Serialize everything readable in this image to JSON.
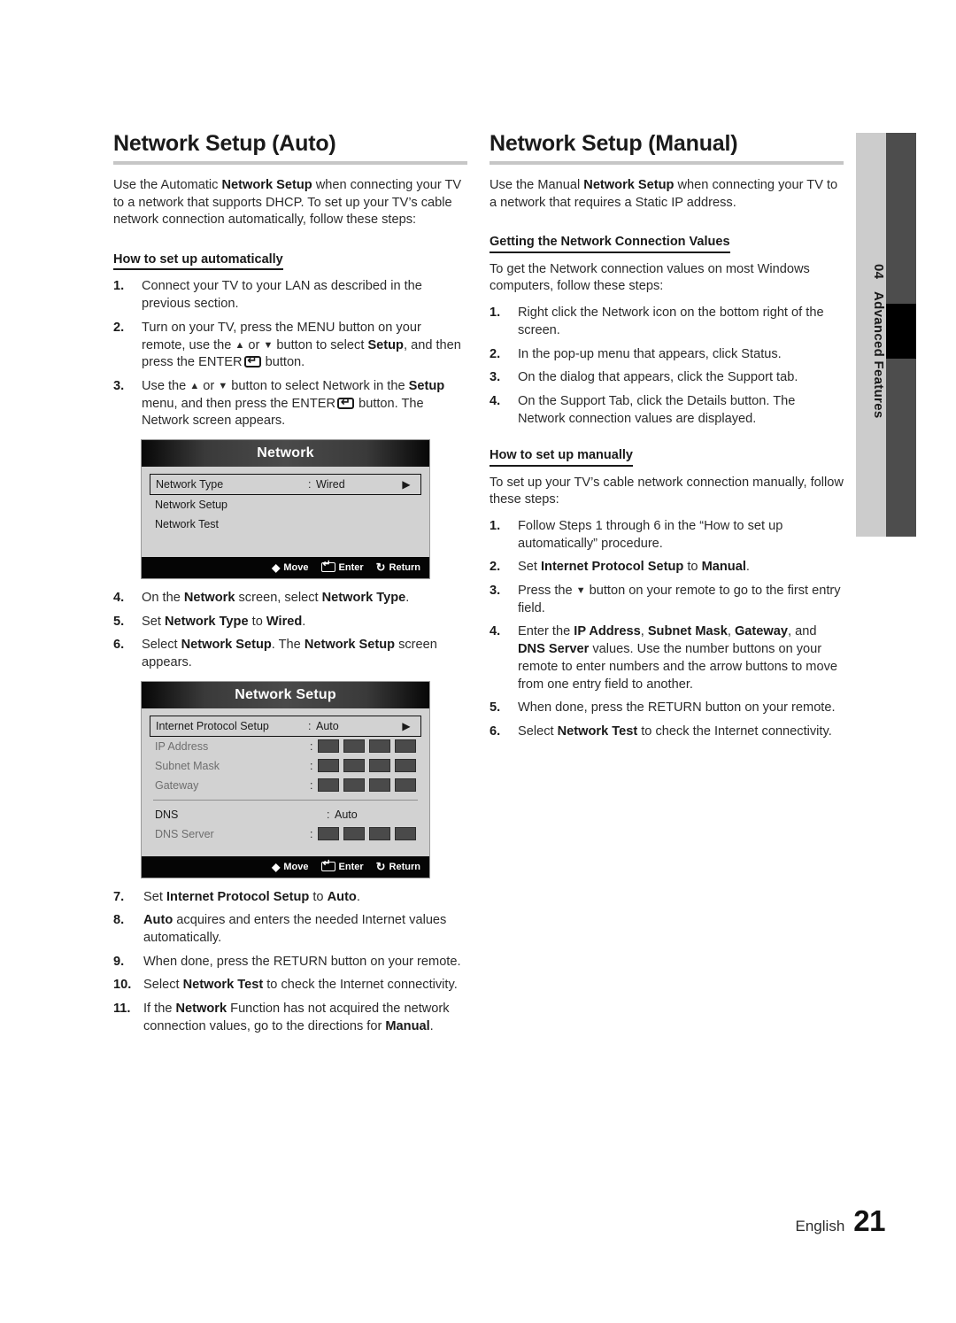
{
  "document": {
    "side_tab": {
      "number": "04",
      "label": "Advanced Features"
    },
    "footer": {
      "language": "English",
      "page_number": "21"
    }
  },
  "left_column": {
    "heading": "Network Setup (Auto)",
    "intro": "Use the Automatic <b>Network Setup</b> when connecting your TV to a network that supports DHCP. To set up your TV’s cable network connection automatically, follow these steps:",
    "subheading": "How to set up automatically",
    "steps_1_3": [
      {
        "num": "1.",
        "text": "Connect your TV to your LAN as described in the previous section."
      },
      {
        "num": "2.",
        "text": "Turn on your TV, press the MENU button on your remote, use the <span class=\"arw\">▲</span> or <span class=\"arw\">▼</span> button to select <b>Setup</b>, and then press the ENTER<span class=\"enterkey\"></span> button."
      },
      {
        "num": "3.",
        "text": "Use the <span class=\"arw\">▲</span> or <span class=\"arw\">▼</span> button to select Network in the <b>Setup</b> menu, and then press the ENTER<span class=\"enterkey\"></span> button. The Network screen appears."
      }
    ],
    "steps_4_6": [
      {
        "num": "4.",
        "text": "On the <b>Network</b> screen, select <b>Network Type</b>."
      },
      {
        "num": "5.",
        "text": "Set <b>Network Type</b> to <b>Wired</b>."
      },
      {
        "num": "6.",
        "text": "Select <b>Network Setup</b>. The <b>Network Setup</b> screen appears."
      }
    ],
    "steps_7_11": [
      {
        "num": "7.",
        "text": "Set <b>Internet Protocol Setup</b> to <b>Auto</b>."
      },
      {
        "num": "8.",
        "text": "<b>Auto</b> acquires and enters the needed Internet values automatically."
      },
      {
        "num": "9.",
        "text": "When done, press the RETURN button on your remote."
      },
      {
        "num": "10.",
        "text": "Select <b>Network Test</b> to check the Internet connectivity."
      },
      {
        "num": "11.",
        "text": "If the <b>Network</b> Function has not acquired the network connection values, go to the directions for <b>Manual</b>."
      }
    ]
  },
  "right_column": {
    "heading": "Network Setup (Manual)",
    "intro": "Use the Manual <b>Network Setup</b> when connecting your TV to a network that requires a Static IP address.",
    "subheading_values": "Getting the Network Connection Values",
    "values_intro": "To get the Network connection values on most Windows computers, follow these steps:",
    "values_steps": [
      {
        "num": "1.",
        "text": "Right click the Network icon on the bottom right of the screen."
      },
      {
        "num": "2.",
        "text": "In the pop-up menu that appears, click Status."
      },
      {
        "num": "3.",
        "text": "On the dialog that appears, click the Support tab."
      },
      {
        "num": "4.",
        "text": "On the Support Tab, click the Details button. The Network connection values are displayed."
      }
    ],
    "subheading_manual": "How to set up manually",
    "manual_intro": "To set up your TV’s cable network connection manually, follow these steps:",
    "manual_steps": [
      {
        "num": "1.",
        "text": "Follow Steps 1 through 6 in the “How to set up automatically” procedure."
      },
      {
        "num": "2.",
        "text": "Set <b>Internet Protocol Setup</b> to <b>Manual</b>."
      },
      {
        "num": "3.",
        "text": "Press the <span class=\"arw\">▼</span> button on your remote to go to the first entry field."
      },
      {
        "num": "4.",
        "text": "Enter the <b>IP Address</b>, <b>Subnet Mask</b>, <b>Gateway</b>, and <b>DNS Server</b> values. Use the number buttons on your remote to enter numbers and the arrow buttons to move from one entry field to another."
      },
      {
        "num": "5.",
        "text": "When done, press the RETURN button on your remote."
      },
      {
        "num": "6.",
        "text": "Select <b>Network Test</b> to check the Internet connectivity."
      }
    ]
  },
  "osd_network": {
    "title": "Network",
    "rows": [
      {
        "label": "Network Type",
        "colon": ":",
        "value": "Wired",
        "selected": true,
        "caret": "▶"
      },
      {
        "label": "Network Setup",
        "colon": "",
        "value": "",
        "selected": false,
        "caret": ""
      },
      {
        "label": "Network Test",
        "colon": "",
        "value": "",
        "selected": false,
        "caret": ""
      }
    ],
    "footer": {
      "move": "Move",
      "enter": "Enter",
      "return": "Return"
    }
  },
  "osd_network_setup": {
    "title": "Network Setup",
    "rows": [
      {
        "label": "Internet Protocol Setup",
        "colon": ":",
        "value": "Auto",
        "selected": true,
        "caret": "▶",
        "masked": false,
        "dim": false
      },
      {
        "label": "IP Address",
        "colon": ":",
        "value": "",
        "selected": false,
        "caret": "",
        "masked": true,
        "dim": true
      },
      {
        "label": "Subnet Mask",
        "colon": ":",
        "value": "",
        "selected": false,
        "caret": "",
        "masked": true,
        "dim": true
      },
      {
        "label": "Gateway",
        "colon": ":",
        "value": "",
        "selected": false,
        "caret": "",
        "masked": true,
        "dim": true
      },
      {
        "label": "DNS",
        "colon": ":",
        "value": "Auto",
        "selected": false,
        "caret": "",
        "masked": false,
        "dim": false
      },
      {
        "label": "DNS Server",
        "colon": ":",
        "value": "",
        "selected": false,
        "caret": "",
        "masked": true,
        "dim": true
      }
    ],
    "footer": {
      "move": "Move",
      "enter": "Enter",
      "return": "Return"
    }
  }
}
